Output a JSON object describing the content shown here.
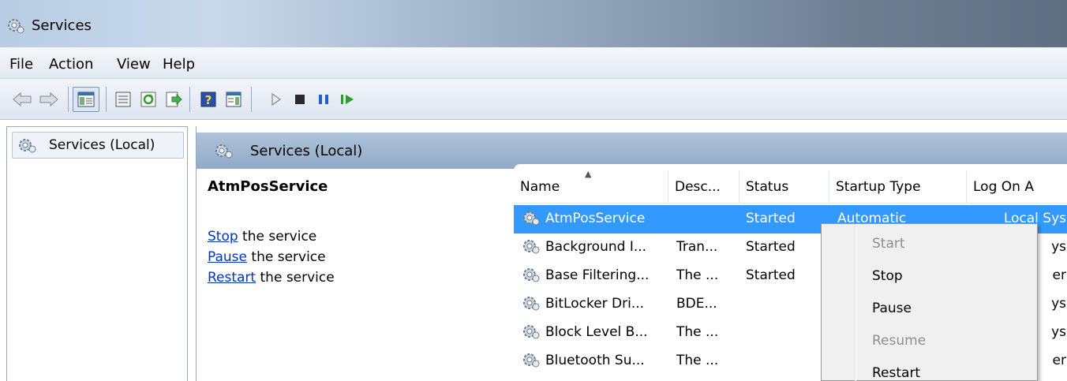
{
  "window": {
    "title": "Services"
  },
  "menu": [
    "File",
    "Action",
    "View",
    "Help"
  ],
  "toolbar": {
    "icons": [
      "back-arrow-icon",
      "forward-arrow-icon",
      "show-hide-console-tree-icon",
      "properties-icon",
      "refresh-icon",
      "export-list-icon",
      "help-icon",
      "show-hide-action-pane-icon",
      "start-service-icon",
      "stop-service-icon",
      "pause-service-icon",
      "resume-service-icon"
    ]
  },
  "tree": {
    "root_label": "Services (Local)"
  },
  "pane": {
    "header": "Services (Local)",
    "selected_service": "AtmPosService",
    "actions": [
      {
        "link": "Stop",
        "rest": " the service"
      },
      {
        "link": "Pause",
        "rest": " the service"
      },
      {
        "link": "Restart",
        "rest": " the service"
      }
    ]
  },
  "columns": [
    "Name",
    "Desc...",
    "Status",
    "Startup Type",
    "Log On A"
  ],
  "services": [
    {
      "name": "AtmPosService",
      "desc": "",
      "status": "Started",
      "startup": "Automatic",
      "logon": "Local Sys"
    },
    {
      "name": "Background I...",
      "desc": "Tran...",
      "status": "Started",
      "startup": "",
      "logon": "ys"
    },
    {
      "name": "Base Filtering...",
      "desc": "The ...",
      "status": "Started",
      "startup": "",
      "logon": "er"
    },
    {
      "name": "BitLocker Dri...",
      "desc": "BDE...",
      "status": "",
      "startup": "",
      "logon": "ys"
    },
    {
      "name": "Block Level B...",
      "desc": "The ...",
      "status": "",
      "startup": "",
      "logon": "ys"
    },
    {
      "name": "Bluetooth Su...",
      "desc": "The ...",
      "status": "",
      "startup": "",
      "logon": "er"
    }
  ],
  "context_menu": [
    {
      "label": "Start",
      "enabled": false
    },
    {
      "label": "Stop",
      "enabled": true
    },
    {
      "label": "Pause",
      "enabled": true
    },
    {
      "label": "Resume",
      "enabled": false
    },
    {
      "label": "Restart",
      "enabled": true
    }
  ],
  "colors": {
    "selection": "#3399ff",
    "link": "#0033cc",
    "pane_header": "#a3bad3"
  }
}
